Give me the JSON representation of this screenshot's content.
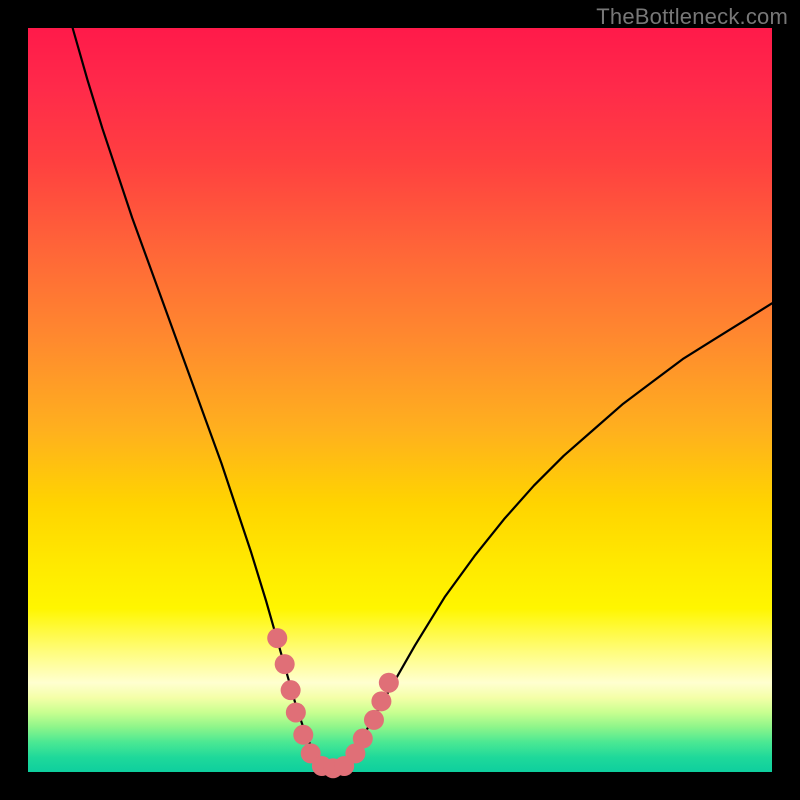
{
  "watermark": "TheBottleneck.com",
  "chart_data": {
    "type": "line",
    "title": "",
    "xlabel": "",
    "ylabel": "",
    "xlim": [
      0,
      100
    ],
    "ylim": [
      0,
      100
    ],
    "series": [
      {
        "name": "curve",
        "x": [
          6,
          8,
          10,
          12,
          14,
          16,
          18,
          20,
          22,
          24,
          26,
          28,
          30,
          32,
          33,
          34,
          35,
          36,
          37,
          38,
          39,
          40,
          41,
          42,
          43,
          44,
          46,
          48,
          50,
          52,
          56,
          60,
          64,
          68,
          72,
          76,
          80,
          84,
          88,
          92,
          96,
          100
        ],
        "y": [
          100,
          93,
          86.5,
          80.5,
          74.5,
          69,
          63.5,
          58,
          52.5,
          47,
          41.5,
          35.5,
          29.5,
          23,
          19.5,
          16,
          12.5,
          9,
          6,
          3.5,
          1.5,
          0.5,
          0.4,
          0.6,
          1.5,
          3,
          6.5,
          10,
          13.5,
          17,
          23.5,
          29,
          34,
          38.5,
          42.5,
          46,
          49.5,
          52.5,
          55.5,
          58,
          60.5,
          63
        ]
      }
    ],
    "markers": {
      "color": "#e06f77",
      "points": [
        {
          "x": 33.5,
          "y": 18
        },
        {
          "x": 34.5,
          "y": 14.5
        },
        {
          "x": 35.3,
          "y": 11
        },
        {
          "x": 36,
          "y": 8
        },
        {
          "x": 37,
          "y": 5
        },
        {
          "x": 38,
          "y": 2.5
        },
        {
          "x": 39.5,
          "y": 0.8
        },
        {
          "x": 41,
          "y": 0.5
        },
        {
          "x": 42.5,
          "y": 0.8
        },
        {
          "x": 44,
          "y": 2.5
        },
        {
          "x": 45,
          "y": 4.5
        },
        {
          "x": 46.5,
          "y": 7
        },
        {
          "x": 47.5,
          "y": 9.5
        },
        {
          "x": 48.5,
          "y": 12
        }
      ]
    },
    "gradient_stops": [
      {
        "pos": 0,
        "color": "#ff1a4a"
      },
      {
        "pos": 50,
        "color": "#ffb000"
      },
      {
        "pos": 75,
        "color": "#ffef00"
      },
      {
        "pos": 100,
        "color": "#0ecf9e"
      }
    ]
  }
}
